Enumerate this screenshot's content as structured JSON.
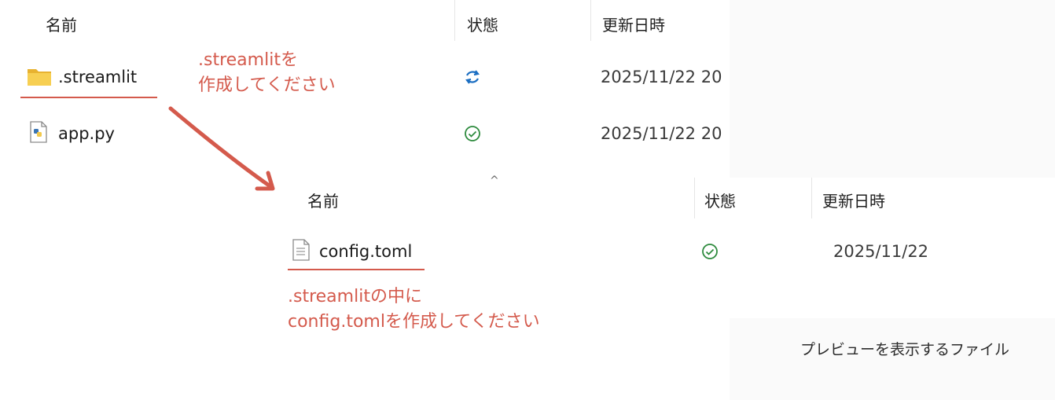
{
  "window1": {
    "columns": {
      "name": "名前",
      "status": "状態",
      "modified": "更新日時"
    },
    "rows": [
      {
        "name": ".streamlit",
        "icon": "folder-icon",
        "status": "sync-pending-icon",
        "date": "2025/11/22 20"
      },
      {
        "name": "app.py",
        "icon": "python-file-icon",
        "status": "synced-check-icon",
        "date": "2025/11/22 20"
      }
    ]
  },
  "window2": {
    "columns": {
      "name": "名前",
      "status": "状態",
      "modified": "更新日時"
    },
    "rows": [
      {
        "name": "config.toml",
        "icon": "text-file-icon",
        "status": "synced-check-icon",
        "date": "2025/11/22"
      }
    ]
  },
  "annotations": {
    "a1_line1": ".streamlitを",
    "a1_line2": "作成してください",
    "a2_line1": ".streamlitの中に",
    "a2_line2": "config.tomlを作成してください"
  },
  "preview": {
    "message": "プレビューを表示するファイル"
  },
  "colors": {
    "annotation": "#d45a4c",
    "sync_blue": "#1b6ec2",
    "ok_green": "#2e8b3e",
    "folder": "#f4c542"
  }
}
